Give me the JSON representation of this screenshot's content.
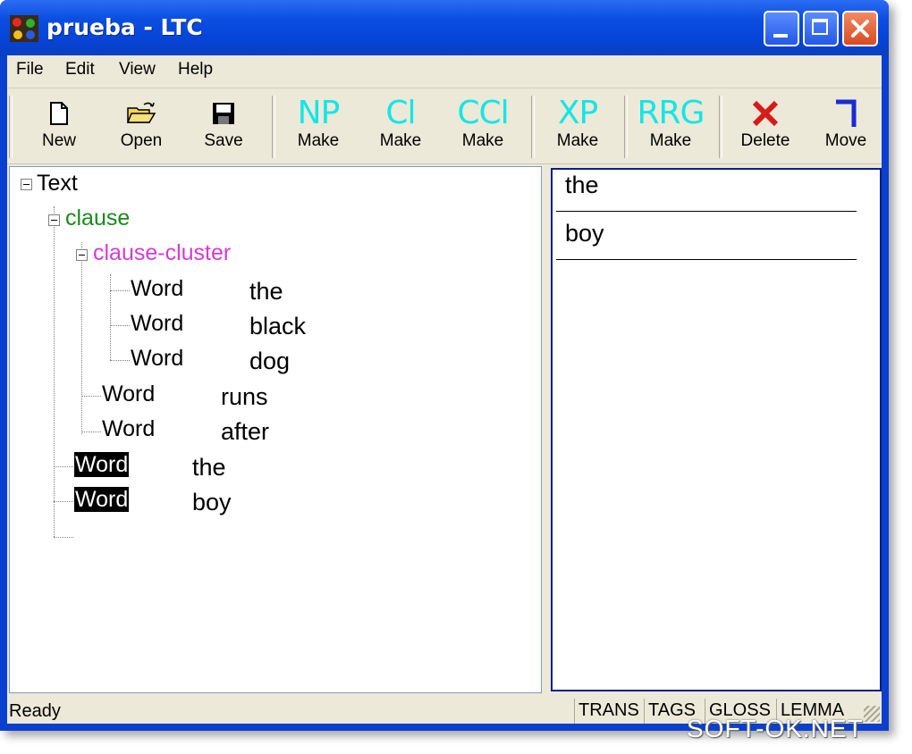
{
  "window": {
    "title": "prueba - LTC",
    "colors": {
      "titlebar": "#0a4ee0",
      "face": "#ece9d8",
      "close": "#d94a21"
    }
  },
  "menu": [
    "File",
    "Edit",
    "View",
    "Help"
  ],
  "toolbar": {
    "new": {
      "label": "New",
      "icon": "new-document-icon"
    },
    "open": {
      "label": "Open",
      "icon": "open-folder-icon"
    },
    "save": {
      "label": "Save",
      "icon": "floppy-disk-icon"
    },
    "np": {
      "glyph": "NP",
      "label": "Make"
    },
    "cl": {
      "glyph": "Cl",
      "label": "Make"
    },
    "ccl": {
      "glyph": "CCl",
      "label": "Make"
    },
    "xp": {
      "glyph": "XP",
      "label": "Make"
    },
    "rrg": {
      "glyph": "RRG",
      "label": "Make"
    },
    "delete": {
      "label": "Delete",
      "icon": "red-x-icon"
    },
    "move": {
      "label": "Move",
      "icon": "move-bracket-icon"
    }
  },
  "tree": {
    "root": "Text",
    "clause": "clause",
    "cluster": "clause-cluster",
    "nodes": [
      {
        "label": "Word",
        "value": "the"
      },
      {
        "label": "Word",
        "value": "black"
      },
      {
        "label": "Word",
        "value": "dog"
      },
      {
        "label": "Word",
        "value": "runs"
      },
      {
        "label": "Word",
        "value": "after"
      },
      {
        "label": "Word",
        "value": "the"
      },
      {
        "label": "Word",
        "value": "boy"
      }
    ],
    "colors": {
      "clause": "#1a8a1a",
      "cluster": "#d63bd6"
    }
  },
  "list": [
    "the",
    "boy"
  ],
  "status": {
    "text": "Ready",
    "panels": [
      "TRANS",
      "TAGS",
      "GLOSS",
      "LEMMA"
    ]
  },
  "watermark": "SOFT-OK.NET"
}
